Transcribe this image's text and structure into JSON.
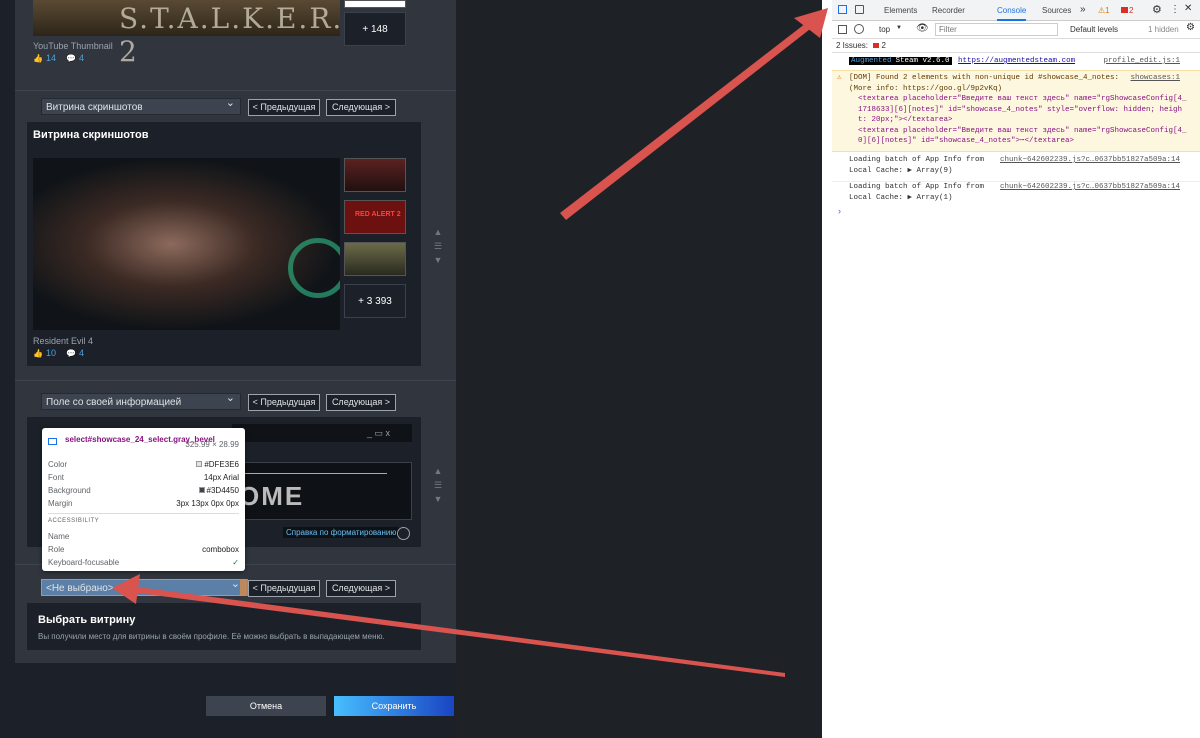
{
  "steam": {
    "first": {
      "caption": "YouTube Thumbnail",
      "likes": "14",
      "comments": "4",
      "more": "+ 148",
      "game_logo": "S.T.A.L.K.E.R. 2"
    },
    "screens": {
      "select": "Витрина скриншотов",
      "prev": "< Предыдущая",
      "next": "Следующая >",
      "title": "Витрина скриншотов",
      "caption": "Resident Evil 4",
      "likes": "10",
      "comments": "4",
      "more": "+ 3 393",
      "thumb2_text": "RED ALERT 2"
    },
    "custom": {
      "select": "Поле со своей информацией",
      "prev": "< Предыдущая",
      "next": "Следующая >",
      "preview_text": "OME",
      "help": "Справка по форматированию"
    },
    "last": {
      "select": "<Не выбрано>",
      "prev": "< Предыдущая",
      "next": "Следующая >",
      "title": "Выбрать витрину",
      "desc": "Вы получили место для витрины в своём профиле. Её можно выбрать в выпадающем меню."
    },
    "cancel": "Отмена",
    "save": "Сохранить"
  },
  "tooltip": {
    "selector": "select#showcase_24_select.gray_bevel",
    "size": "325.99 × 28.99",
    "rows": [
      {
        "k": "Color",
        "v": "#DFE3E6",
        "sw": "#DFE3E6"
      },
      {
        "k": "Font",
        "v": "14px Arial"
      },
      {
        "k": "Background",
        "v": "#3D4450",
        "sw": "#3D4450"
      },
      {
        "k": "Margin",
        "v": "3px 13px 0px 0px"
      }
    ],
    "acc": "ACCESSIBILITY",
    "acc_rows": [
      {
        "k": "Name",
        "v": ""
      },
      {
        "k": "Role",
        "v": "combobox"
      },
      {
        "k": "Keyboard-focusable",
        "v": "✓"
      }
    ]
  },
  "devtools": {
    "tabs": [
      "Elements",
      "Recorder",
      "Console",
      "Sources"
    ],
    "warn_count": "1",
    "err_count": "2",
    "context": "top",
    "filter_placeholder": "Filter",
    "levels": "Default levels",
    "hidden": "1 hidden",
    "issues_label": "2 Issues:",
    "issues_count": "2",
    "log1": {
      "badge1": "Augmented",
      "badge2": "Steam v2.6.0",
      "url": "https://augmentedsteam.com",
      "src": "profile_edit.js:1"
    },
    "warn": {
      "line1": "[DOM] Found 2 elements with non-unique id #showcase_4_notes:",
      "src": "showcases:1",
      "line2": "(More info: https://goo.gl/9p2vKq)",
      "l3": "<textarea placeholder=\"Введите ваш текст здесь\" name=\"rgShowcaseConfig[4_",
      "l4": "1718633][6][notes]\" id=\"showcase_4_notes\" style=\"overflow: hidden; heigh",
      "l5": "t: 20px;\"></textarea>",
      "l6": "<textarea placeholder=\"Введите ваш текст здесь\" name=\"rgShowcaseConfig[4_",
      "l7": "0][6][notes]\" id=\"showcase_4_notes\">⋯</textarea>"
    },
    "log2": {
      "l1": "Loading batch of App Info from",
      "l2": "Local Cache:  ▶ Array(9)",
      "src": "chunk~642602239.js?c…0637bb51827a509a:14"
    },
    "log3": {
      "l1": "Loading batch of App Info from",
      "l2": "Local Cache:  ▶ Array(1)",
      "src": "chunk~642602239.js?c…0637bb51827a509a:14"
    }
  },
  "colors": {
    "arrow": "#d9534f",
    "devtools_active": "#1a73e8"
  }
}
